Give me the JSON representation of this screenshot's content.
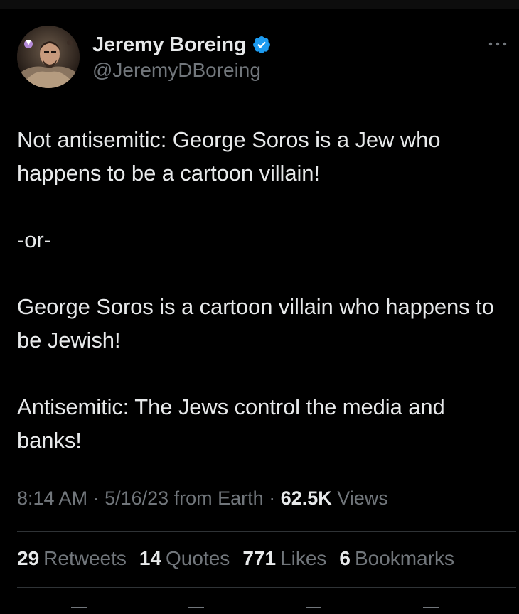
{
  "author": {
    "display_name": "Jeremy Boreing",
    "handle": "@JeremyDBoreing",
    "verified_icon": "verified-badge-icon",
    "avatar_icon": "profile-avatar"
  },
  "tweet": {
    "paragraphs": [
      "Not antisemitic: George Soros is a Jew who happens to be a cartoon villain!",
      "-or-",
      "George Soros is a cartoon villain who happens to be Jewish!",
      "Antisemitic: The Jews control the media and banks!"
    ]
  },
  "meta": {
    "time": "8:14 AM",
    "sep1": " · ",
    "date": "5/16/23",
    "source": " from Earth",
    "sep2": " · ",
    "views_count": "62.5K",
    "views_label": " Views"
  },
  "stats": {
    "retweets_count": "29",
    "retweets_label": "Retweets",
    "quotes_count": "14",
    "quotes_label": "Quotes",
    "likes_count": "771",
    "likes_label": "Likes",
    "bookmarks_count": "6",
    "bookmarks_label": "Bookmarks"
  },
  "colors": {
    "background": "#000000",
    "text_primary": "#e7e9ea",
    "text_secondary": "#71767b",
    "verified": "#1d9bf0",
    "divider": "#2f3336"
  }
}
